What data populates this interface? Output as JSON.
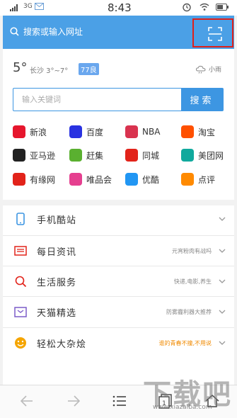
{
  "status_bar": {
    "network": "3G",
    "time": "8:43",
    "battery_level": 0.7
  },
  "topbar": {
    "search_placeholder": "搜索或输入网址",
    "icons": [
      "search-icon",
      "scan-icon"
    ]
  },
  "weather": {
    "temperature": "5°",
    "city_range": "长沙 3°~7°",
    "aqi": "77良",
    "condition": "小雨",
    "condition_icon": "cloud-rain-icon"
  },
  "search": {
    "placeholder": "输入关键词",
    "button": "搜索"
  },
  "sites": [
    {
      "label": "新浪",
      "icon": "weibo-icon",
      "color": "#e6162d"
    },
    {
      "label": "百度",
      "icon": "baidu-icon",
      "color": "#2932e1"
    },
    {
      "label": "NBA",
      "icon": "nba-icon",
      "color": "#d9334f"
    },
    {
      "label": "淘宝",
      "icon": "taobao-icon",
      "color": "#ff5000"
    },
    {
      "label": "亚马逊",
      "icon": "amazon-icon",
      "color": "#222222"
    },
    {
      "label": "赶集",
      "icon": "ganji-icon",
      "color": "#5ab030"
    },
    {
      "label": "同城",
      "icon": "58-icon",
      "color": "#e2231a"
    },
    {
      "label": "美团网",
      "icon": "meituan-icon",
      "color": "#10a99d"
    },
    {
      "label": "有缘网",
      "icon": "youyuan-icon",
      "color": "#e2231a"
    },
    {
      "label": "唯品会",
      "icon": "vip-icon",
      "color": "#e53f8f"
    },
    {
      "label": "优酷",
      "icon": "youku-icon",
      "color": "#2196f3"
    },
    {
      "label": "点评",
      "icon": "dianping-icon",
      "color": "#ff8a00"
    }
  ],
  "rows": [
    {
      "label": "手机酷站",
      "sub": "",
      "icon": "phone-icon",
      "color": "#3d96e2"
    },
    {
      "label": "每日资讯",
      "sub": "元宵粉肉有战吗",
      "icon": "news-icon",
      "color": "#e2231a"
    },
    {
      "label": "生活服务",
      "sub": "快递,电影,养生",
      "icon": "search-icon",
      "color": "#e2231a"
    },
    {
      "label": "天猫精选",
      "sub": "防雾霾利器大推荐",
      "icon": "tmall-icon",
      "color": "#7c5cc9"
    },
    {
      "label": "轻松大杂烩",
      "sub": "谁的青春不撞,不用说",
      "icon": "smile-icon",
      "color": "#f5a500",
      "sub_color": "#f08a00"
    }
  ],
  "nav": {
    "icons": [
      "back-icon",
      "forward-icon",
      "menu-icon",
      "tabs-icon",
      "home-icon"
    ],
    "tab_count": "1"
  },
  "watermark": {
    "text": "下载吧",
    "url": "www.xiazaiba.com"
  }
}
